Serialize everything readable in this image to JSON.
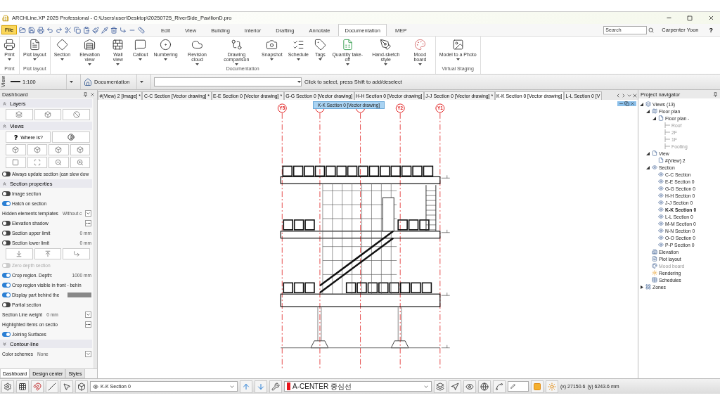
{
  "window": {
    "title": "ARCHLine.XP 2025 Professional - C:\\Users\\user\\Desktop\\20250725_RiverSide_PavilionD.pro"
  },
  "menu": {
    "file": "File",
    "tabs": [
      {
        "label": "Edit",
        "selected": false
      },
      {
        "label": "View",
        "selected": false
      },
      {
        "label": "Building",
        "selected": false
      },
      {
        "label": "Interior",
        "selected": false
      },
      {
        "label": "Drafting",
        "selected": false
      },
      {
        "label": "Annotate",
        "selected": false
      },
      {
        "label": "Documentation",
        "selected": true
      },
      {
        "label": "MEP",
        "selected": false
      }
    ],
    "search": {
      "placeholder": "Search"
    },
    "user": "Carpenter Yoon",
    "help": "?"
  },
  "ribbon": {
    "groups": [
      {
        "label": "Print",
        "buttons": [
          {
            "label": "Print",
            "dropdown": true
          }
        ]
      },
      {
        "label": "Plot layout",
        "buttons": [
          {
            "label": "Plot layout",
            "dropdown": true
          }
        ]
      },
      {
        "label": "Documentation",
        "buttons": [
          {
            "label": "Section",
            "dropdown": true
          },
          {
            "label": "Elevation view",
            "dropdown": true
          },
          {
            "label": "Wall view",
            "dropdown": true
          },
          {
            "label": "Callout",
            "dropdown": true
          },
          {
            "label": "Numbering",
            "dropdown": true
          },
          {
            "label": "Revision cloud",
            "dropdown": true
          },
          {
            "label": "Drawing comparison",
            "dropdown": true
          },
          {
            "label": "Snapshot",
            "dropdown": true
          },
          {
            "label": "Schedule",
            "dropdown": true
          },
          {
            "label": "Tags",
            "dropdown": true
          },
          {
            "label": "Quantity take-off",
            "dropdown": true
          },
          {
            "label": "Hand-sketch style",
            "dropdown": true
          },
          {
            "label": "Mood board",
            "dropdown": true
          }
        ]
      },
      {
        "label": "Virtual Staging",
        "buttons": [
          {
            "label": "Model to a Photo",
            "dropdown": true
          }
        ]
      }
    ]
  },
  "view_toolbar": {
    "label": "View",
    "scale": "1:100",
    "layer_set": "Documentation",
    "status": "Click to select, press Shift to add/deselect"
  },
  "dashboard": {
    "title": "Dashboard",
    "sections": [
      {
        "title": "Layers",
        "expanded": true,
        "items": [
          {
            "kind": "icon_row"
          }
        ]
      },
      {
        "title": "Views",
        "expanded": true,
        "items": [
          {
            "kind": "where",
            "label": "Where is?"
          },
          {
            "kind": "icon_row"
          },
          {
            "kind": "icon_row"
          },
          {
            "kind": "toggle",
            "label": "Always update section (can slow dow",
            "on": false,
            "disabled": false
          }
        ]
      },
      {
        "title": "Section properties",
        "expanded": true,
        "items": [
          {
            "kind": "toggle",
            "label": "Image section",
            "on": false,
            "disabled": false
          },
          {
            "kind": "toggle",
            "label": "Hatch on section",
            "on": true,
            "disabled": false
          },
          {
            "kind": "select",
            "label": "Hidden elements templates",
            "value": "Without c"
          },
          {
            "kind": "toggle_more",
            "label": "Elevation shadow",
            "on": false,
            "disabled": false
          },
          {
            "kind": "toggle_value",
            "label": "Section upper limit",
            "value": "0 mm",
            "on": false,
            "disabled": false
          },
          {
            "kind": "toggle_value",
            "label": "Section lower limit",
            "value": "0 mm",
            "on": false,
            "disabled": false
          },
          {
            "kind": "icon_row"
          },
          {
            "kind": "toggle",
            "label": "Zero depth section",
            "on": false,
            "disabled": true
          },
          {
            "kind": "toggle_value",
            "label": "Crop region. Depth:",
            "value": "1000 mm",
            "on": true,
            "disabled": false
          },
          {
            "kind": "toggle",
            "label": "Crop region visible in front - behin",
            "on": true,
            "disabled": false
          },
          {
            "kind": "toggle_bar",
            "label": "Display part behind the",
            "on": true,
            "disabled": false
          },
          {
            "kind": "toggle",
            "label": "Partial section",
            "on": false,
            "disabled": false
          },
          {
            "kind": "select",
            "label": "Section Line weight",
            "value": "0 mm"
          },
          {
            "kind": "more",
            "label": "Highlighted items on sectio"
          },
          {
            "kind": "toggle",
            "label": "Joining Surfaces",
            "on": true,
            "disabled": false
          }
        ]
      },
      {
        "title": "Contour-line",
        "expanded": false
      }
    ],
    "footer_rows": [
      {
        "kind": "select",
        "label": "Color schemes",
        "value": "None"
      }
    ],
    "tabs": [
      {
        "label": "Dashboard",
        "selected": true
      },
      {
        "label": "Design center",
        "selected": false
      },
      {
        "label": "Styles",
        "selected": false
      }
    ]
  },
  "document_tabs": [
    {
      "label": "#(View) 2 [Image] *",
      "selected": false
    },
    {
      "label": "C-C Section [Vector drawing] *",
      "selected": false
    },
    {
      "label": "E-E Section 0 [Vector drawing] *",
      "selected": false
    },
    {
      "label": "G-G Section 0 [Vector drawing]",
      "selected": false
    },
    {
      "label": "H-H Section 0 [Vector drawing]",
      "selected": false
    },
    {
      "label": "J-J Section 0 [Vector drawing] *",
      "selected": false
    },
    {
      "label": "K-K Section 0 [Vector drawing]",
      "selected": true
    },
    {
      "label": "L-L Section 0 [V",
      "selected": false
    }
  ],
  "drawing": {
    "grid_labels": [
      "Y5",
      "Y2",
      "Y1"
    ],
    "tooltip": "K-K Section 0 [Vector drawing]"
  },
  "navigator": {
    "title": "Project navigator",
    "tree": [
      {
        "label": "Views (13)",
        "kind": "views",
        "expanded": true,
        "selected": false,
        "disabled": false,
        "children": [
          {
            "label": "Floor plan",
            "kind": "floorplan",
            "expanded": true,
            "selected": false,
            "disabled": false,
            "children": [
              {
                "label": "Floor plan -",
                "kind": "page",
                "expanded": true,
                "selected": false,
                "disabled": false,
                "children": [
                  {
                    "label": "Roof",
                    "kind": "level",
                    "selected": false,
                    "disabled": true
                  },
                  {
                    "label": "2F",
                    "kind": "level",
                    "selected": false,
                    "disabled": true
                  },
                  {
                    "label": "1F",
                    "kind": "level",
                    "selected": false,
                    "disabled": true
                  },
                  {
                    "label": "Footing",
                    "kind": "level",
                    "selected": false,
                    "disabled": true
                  }
                ]
              }
            ]
          },
          {
            "label": "View",
            "kind": "page",
            "expanded": true,
            "selected": false,
            "disabled": false,
            "children": [
              {
                "label": "#(View) 2",
                "kind": "page",
                "selected": false,
                "disabled": false
              }
            ]
          },
          {
            "label": "Section",
            "kind": "section",
            "expanded": true,
            "selected": false,
            "disabled": false,
            "children": [
              {
                "label": "C-C Section",
                "kind": "section",
                "selected": false,
                "disabled": false
              },
              {
                "label": "E-E Section 0",
                "kind": "section",
                "selected": false,
                "disabled": false
              },
              {
                "label": "G-G Section 0",
                "kind": "section",
                "selected": false,
                "disabled": false
              },
              {
                "label": "H-H Section 0",
                "kind": "section",
                "selected": false,
                "disabled": false
              },
              {
                "label": "J-J Section 0",
                "kind": "section",
                "selected": false,
                "disabled": false
              },
              {
                "label": "K-K Section 0",
                "kind": "section",
                "selected": true,
                "disabled": false
              },
              {
                "label": "L-L Section 0",
                "kind": "section",
                "selected": false,
                "disabled": false
              },
              {
                "label": "M-M Section 0",
                "kind": "section",
                "selected": false,
                "disabled": false
              },
              {
                "label": "N-N Section 0",
                "kind": "section",
                "selected": false,
                "disabled": false
              },
              {
                "label": "O-O Section 0",
                "kind": "section",
                "selected": false,
                "disabled": false
              },
              {
                "label": "P-P Section 0",
                "kind": "section",
                "selected": false,
                "disabled": false
              }
            ]
          },
          {
            "label": "Elevation",
            "kind": "elevation",
            "selected": false,
            "disabled": false
          },
          {
            "label": "Plot layout",
            "kind": "plot",
            "selected": false,
            "disabled": false
          },
          {
            "label": "Mood board",
            "kind": "mood",
            "selected": false,
            "disabled": true
          },
          {
            "label": "Rendering",
            "kind": "rendering",
            "selected": false,
            "disabled": false
          },
          {
            "label": "Schedules",
            "kind": "schedules",
            "selected": false,
            "disabled": false
          }
        ]
      },
      {
        "label": "Zones",
        "kind": "zones",
        "expanded": false,
        "selected": false,
        "disabled": false
      }
    ]
  },
  "status_bar": {
    "section": "K-K Section 0",
    "layer": {
      "name": "A-CENTER 중심선",
      "color": "#e8141b"
    },
    "x": "(x) 27150.6",
    "y": "(y) 6243.6 mm"
  }
}
